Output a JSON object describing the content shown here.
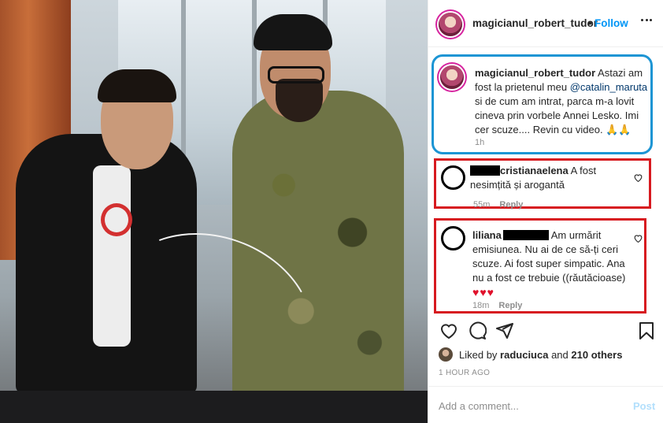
{
  "post": {
    "image_alt_icon": "photo-two-men-cutting-cable"
  },
  "header": {
    "username": "magicianul_robert_tudor",
    "separator": "•",
    "follow_label": "Follow",
    "more_icon": "more-dots-icon"
  },
  "caption": {
    "username": "magicianul_robert_tudor",
    "text_before": " Astazi am fost la prietenul meu ",
    "mention": "@catalin_maruta",
    "text_after": " si de cum am intrat, parca m-a lovit cineva prin vorbele Annei Lesko. Imi cer scuze.... Revin cu video. 🙏🙏",
    "time": "1h"
  },
  "comments": [
    {
      "username": "cristianaelena",
      "text": " A fost nesimțită și arogantă",
      "time": "55m",
      "reply_label": "Reply"
    },
    {
      "username": "liliana",
      "text": " Am urmărit emisiunea. Nu ai de ce să-ți ceri scuze. Ai fost super simpatic. Ana nu a fost ce trebuie ((răutăcioase)",
      "hearts": "♥♥♥",
      "time": "18m",
      "reply_label": "Reply"
    }
  ],
  "likes": {
    "prefix": "Liked by ",
    "user": "raduciuca",
    "middle": " and ",
    "others": "210 others"
  },
  "timestamp": "1 HOUR AGO",
  "comment_box": {
    "placeholder": "Add a comment...",
    "post_label": "Post"
  },
  "colors": {
    "accent": "#0095f6",
    "caption_outline": "#1c95d4",
    "comment_outline": "#d71a20",
    "heart": "#e0112b"
  }
}
